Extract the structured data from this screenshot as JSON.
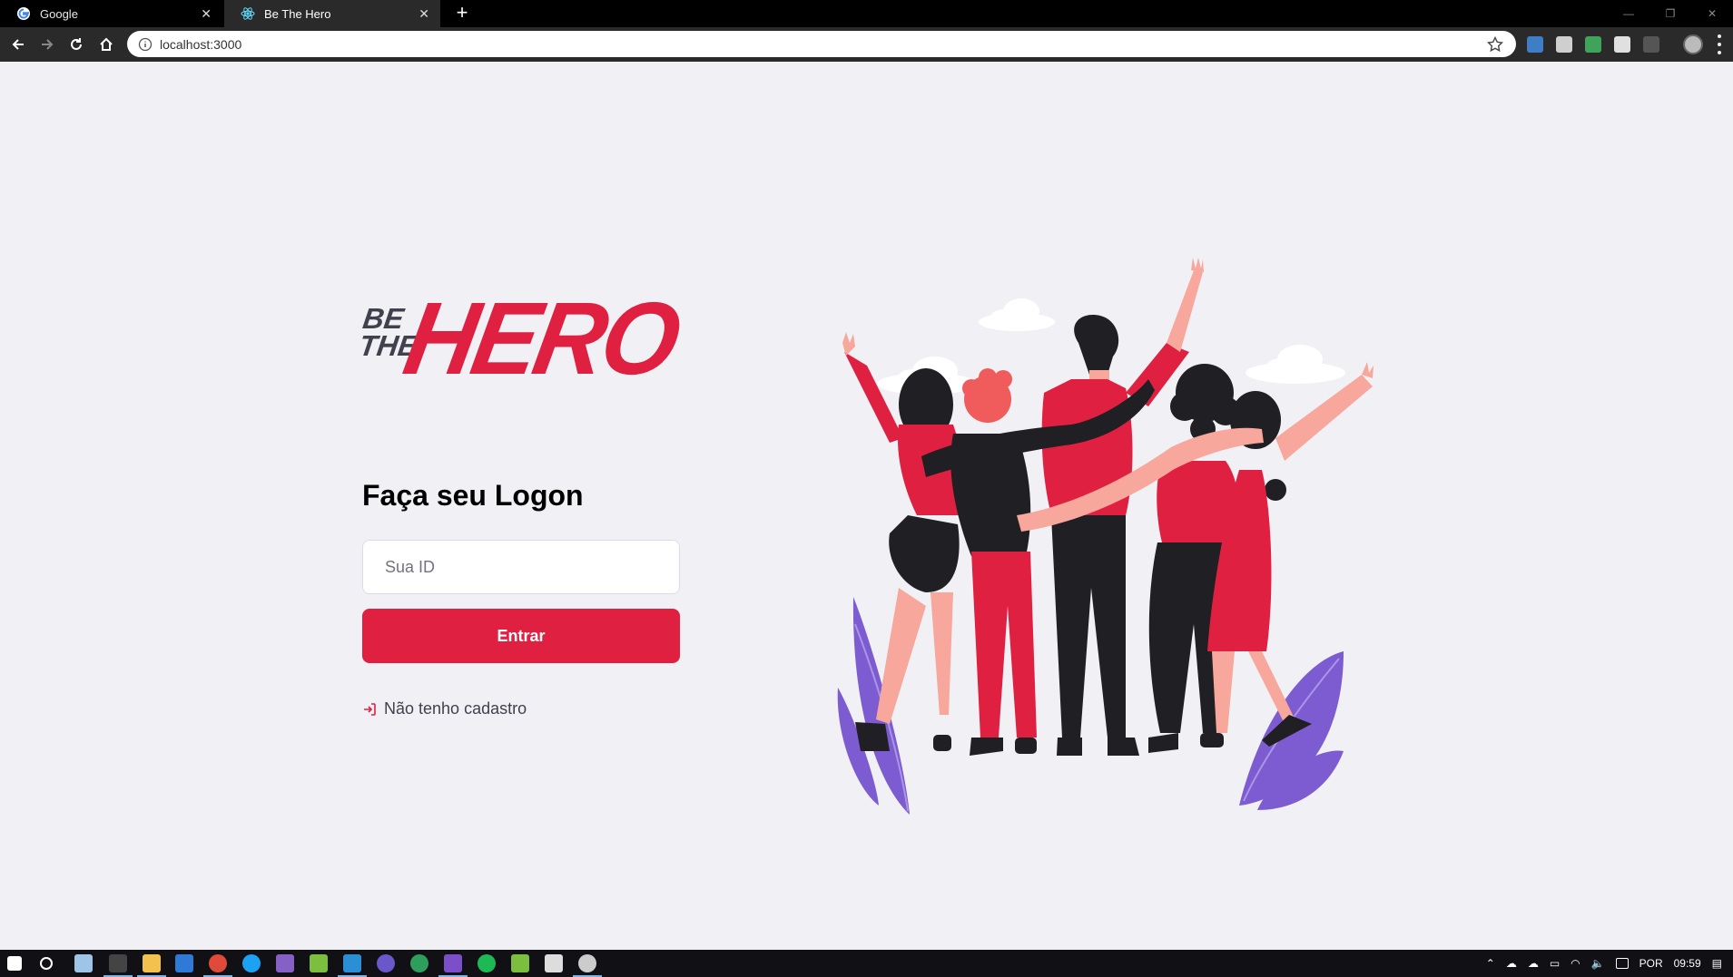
{
  "browser": {
    "tabs": [
      {
        "title": "Google",
        "active": false
      },
      {
        "title": "Be The Hero",
        "active": true
      }
    ],
    "new_tab_label": "+",
    "url": "localhost:3000"
  },
  "logo": {
    "be": "BE",
    "the": "THE",
    "hero": "HERO"
  },
  "login": {
    "title": "Faça seu Logon",
    "id_placeholder": "Sua ID",
    "submit_label": "Entrar",
    "register_link": "Não tenho cadastro"
  },
  "colors": {
    "primary": "#e02041",
    "text": "#41414d",
    "background": "#f0f0f5",
    "leaf_purple": "#7d5bd0"
  },
  "taskbar": {
    "language": "POR",
    "time": "09:59"
  }
}
